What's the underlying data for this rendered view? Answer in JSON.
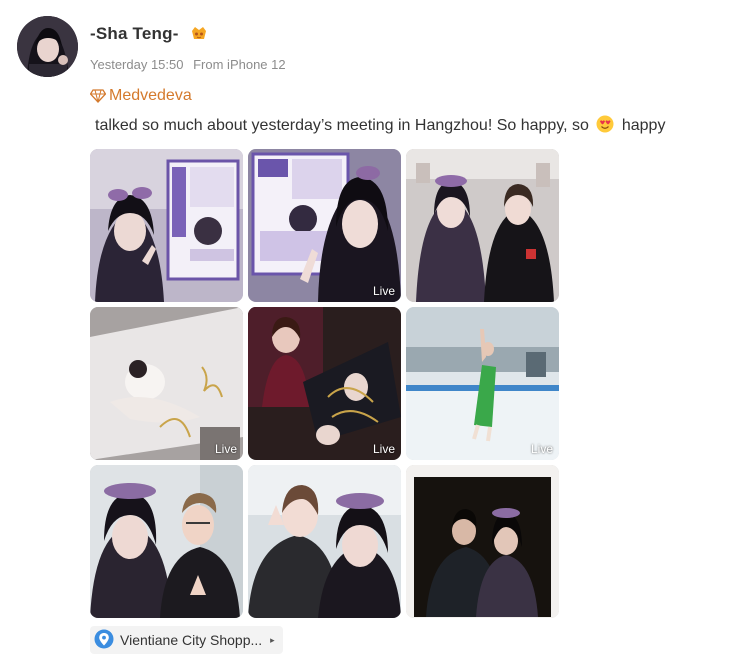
{
  "post": {
    "username": "-Sha Teng-",
    "timestamp": "Yesterday 15:50",
    "source": "From iPhone 12",
    "topic": "Medvedeva",
    "text_before_emoji": "talked so much about yesterday’s meeting in Hangzhou! So happy, so",
    "text_after_emoji": "happy",
    "live_label": "Live",
    "location": "Vientiane City Shopp...",
    "colors": {
      "topic": "#d47a2d",
      "location_pin": "#3b8de0"
    },
    "photos": [
      {
        "id": "photo-1",
        "live": false
      },
      {
        "id": "photo-2",
        "live": true
      },
      {
        "id": "photo-3",
        "live": false
      },
      {
        "id": "photo-4",
        "live": true
      },
      {
        "id": "photo-5",
        "live": true
      },
      {
        "id": "photo-6",
        "live": true
      },
      {
        "id": "photo-7",
        "live": false
      },
      {
        "id": "photo-8",
        "live": false
      },
      {
        "id": "photo-9",
        "live": false
      }
    ]
  }
}
